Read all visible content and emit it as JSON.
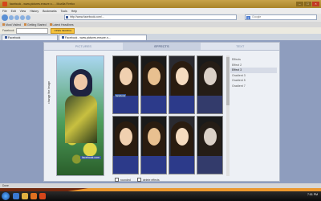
{
  "window": {
    "title": "facebook - www.pictures.ensure.n... - Mozilla Firefox"
  },
  "menu": [
    "File",
    "Edit",
    "View",
    "History",
    "Bookmarks",
    "Tools",
    "Help"
  ],
  "address_bar": {
    "url": "http://www.facebook.com/...",
    "search_placeholder": "Google"
  },
  "bookmarks": [
    "Most Visited",
    "Getting Started",
    "Latest Headlines"
  ],
  "toolbar2": {
    "label": "Facebook",
    "button": "OPEN SEARCH"
  },
  "tabs": [
    {
      "label": "Facebook"
    },
    {
      "label": "Facebook - www.pictures.ensure.n..."
    }
  ],
  "app": {
    "tabs": [
      "PICTURES",
      "EFFECTS",
      "TEXT"
    ],
    "active_tab": "EFFECTS",
    "side_label": "change the Image",
    "preview_watermark": "facebook.com",
    "thumbnail_watermark": "facebook",
    "effects": [
      "Effects",
      "Effect 2",
      "Effect 3",
      "Gradient 3",
      "Gradient 5",
      "Gradient 7"
    ],
    "selected_effect": "Effect 3",
    "footer": {
      "rounded_label": "rounded",
      "delete_label": "delete effects"
    }
  },
  "status": {
    "text": "Done"
  },
  "taskbar": {
    "time": "7:01 PM"
  }
}
